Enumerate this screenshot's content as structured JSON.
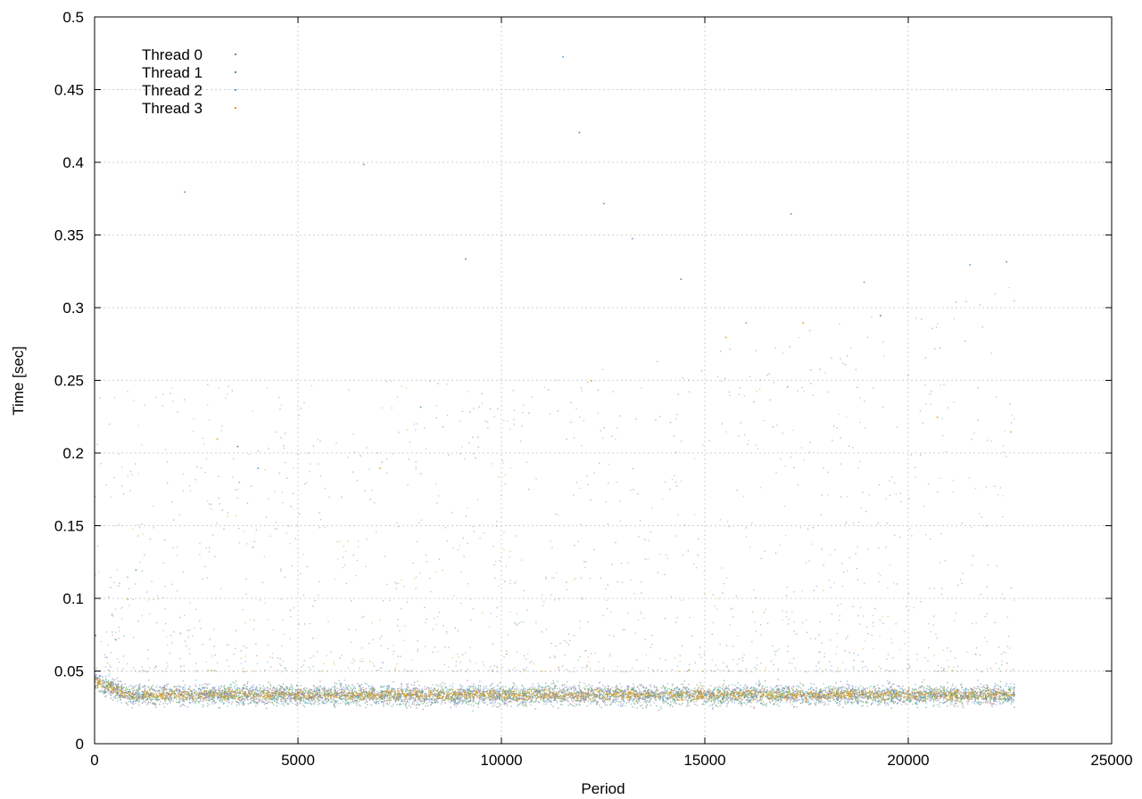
{
  "chart_data": {
    "type": "scatter",
    "title": "",
    "xlabel": "Period",
    "ylabel": "Time [sec]",
    "xlim": [
      0,
      25000
    ],
    "ylim": [
      0,
      0.5
    ],
    "x_ticks": [
      0,
      5000,
      10000,
      15000,
      20000,
      25000
    ],
    "x_tick_labels": [
      "0",
      "5000",
      "10000",
      "15000",
      "20000",
      "25000"
    ],
    "y_ticks": [
      0,
      0.05,
      0.1,
      0.15,
      0.2,
      0.25,
      0.3,
      0.35,
      0.4,
      0.45,
      0.5
    ],
    "y_tick_labels": [
      "0",
      "0.05",
      "0.1",
      "0.15",
      "0.2",
      "0.25",
      "0.3",
      "0.35",
      "0.4",
      "0.45",
      "0.5"
    ],
    "grid": true,
    "legend_position": "top-left",
    "series": [
      {
        "name": "Thread 0",
        "color": "#9a6fa0",
        "x": [
          10,
          2200,
          6600,
          12500,
          17100,
          22400
        ],
        "y": [
          0.075,
          0.38,
          0.399,
          0.372,
          0.365,
          0.332
        ]
      },
      {
        "name": "Thread 1",
        "color": "#4a9e52",
        "x": [
          500,
          3500,
          9100,
          11900,
          14400,
          19300
        ],
        "y": [
          0.072,
          0.205,
          0.334,
          0.421,
          0.32,
          0.295
        ]
      },
      {
        "name": "Thread 2",
        "color": "#5ba3dc",
        "x": [
          1000,
          4000,
          8000,
          11500,
          13200,
          16000,
          18900,
          21500
        ],
        "y": [
          0.12,
          0.19,
          0.232,
          0.473,
          0.348,
          0.29,
          0.318,
          0.33
        ]
      },
      {
        "name": "Thread 3",
        "color": "#e0a020",
        "x": [
          800,
          3000,
          7000,
          12200,
          15500,
          17400,
          20700,
          22500
        ],
        "y": [
          0.1,
          0.21,
          0.19,
          0.25,
          0.28,
          0.29,
          0.225,
          0.215
        ]
      }
    ],
    "x_extent_of_data": 22600,
    "dense_band": {
      "x_range": [
        0,
        22600
      ],
      "y_center": 0.034,
      "y_spread": [
        0.02,
        0.05
      ]
    }
  }
}
